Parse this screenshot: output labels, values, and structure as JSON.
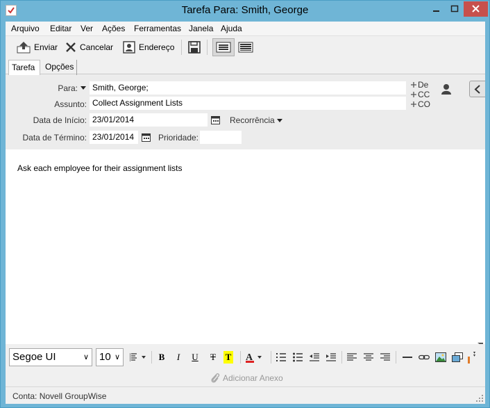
{
  "window": {
    "title": "Tarefa Para: Smith, George"
  },
  "menu": [
    "Arquivo",
    "Editar",
    "Ver",
    "Ações",
    "Ferramentas",
    "Janela",
    "Ajuda"
  ],
  "toolbar": {
    "send_label": "Enviar",
    "cancel_label": "Cancelar",
    "address_label": "Endereço"
  },
  "tabs": [
    "Tarefa",
    "Opções"
  ],
  "header": {
    "to_label": "Para:",
    "to_value": "Smith, George;",
    "subject_label": "Assunto:",
    "subject_value": "Collect Assignment Lists",
    "start_label": "Data de Início:",
    "start_value": "23/01/2014",
    "recurrence_label": "Recorrência",
    "end_label": "Data de Término:",
    "end_value": "23/01/2014",
    "priority_label": "Prioridade:",
    "priority_value": "",
    "from_link": "De",
    "cc_link": "CC",
    "bcc_link": "CO"
  },
  "body": {
    "text": "Ask each employee for their assignment lists"
  },
  "format": {
    "font": "Segoe UI",
    "size": "10",
    "bold": "B",
    "italic": "I",
    "underline": "U",
    "strike": "T",
    "highlight": "T"
  },
  "attach_label": "Adicionar Anexo",
  "status": "Conta: Novell GroupWise",
  "colors": {
    "title_bar": "#6fb5d6",
    "close_button": "#c7504c",
    "highlight": "#ffff00"
  }
}
